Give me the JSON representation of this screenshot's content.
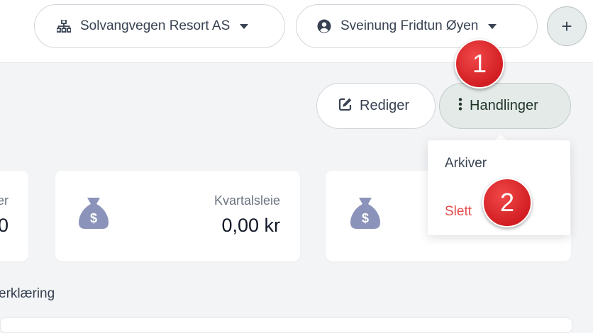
{
  "header": {
    "organization": {
      "label": "Solvangvegen Resort AS",
      "icon": "sitemap-icon"
    },
    "user": {
      "label": "Sveinung Fridtun Øyen",
      "icon": "user-circle-icon"
    },
    "add_label": "+"
  },
  "toolbar": {
    "edit_label": "Rediger",
    "actions_label": "Handlinger"
  },
  "actions_menu": {
    "items": [
      {
        "label": "Arkiver"
      },
      {
        "label": "Slett"
      }
    ]
  },
  "cards": [
    {
      "label": "er",
      "value": "0"
    },
    {
      "label": "Kvartalsleie",
      "value": "0,00 kr",
      "icon": "money-bag-icon"
    },
    {
      "icon": "money-bag-icon"
    }
  ],
  "section": {
    "label": "erklæring"
  },
  "markers": [
    "1",
    "2"
  ],
  "colors": {
    "delete": "#e24c4b",
    "marker": "#d21e22",
    "bag": "#8c93ba"
  }
}
